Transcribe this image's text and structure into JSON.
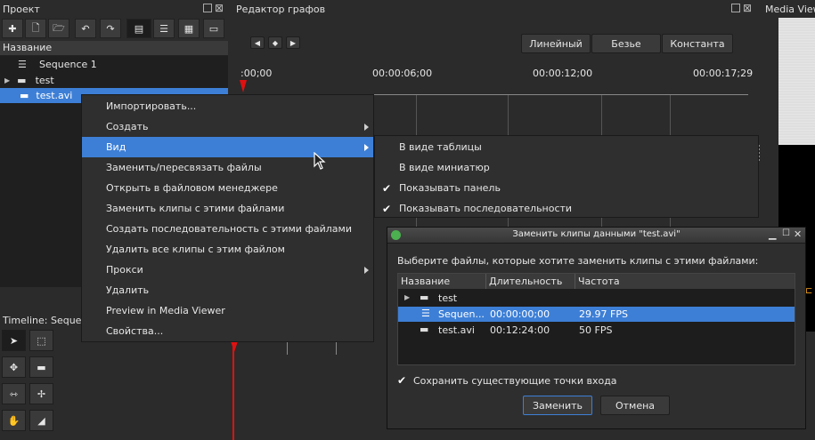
{
  "project": {
    "title": "Проект",
    "column": "Название",
    "items": [
      "Sequence 1",
      "test",
      "test.avi"
    ]
  },
  "graph": {
    "title": "Редактор графов",
    "btn_linear": "Линейный",
    "btn_bezier": "Безье",
    "btn_const": "Константа",
    "times": [
      ":00;00",
      "00:00:06;00",
      "00:00:12;00",
      "00:00:17;29"
    ]
  },
  "media": {
    "title": "Media View"
  },
  "timeline": {
    "title": "Timeline: Seque"
  },
  "context_menu": {
    "items": [
      "Импортировать...",
      "Создать",
      "Вид",
      "Заменить/пересвязать файлы",
      "Открыть в файловом менеджере",
      "Заменить клипы с этими файлами",
      "Создать последовательность с этими файлами",
      "Удалить все клипы с этим файлом",
      "Прокси",
      "Удалить",
      "Preview in Media Viewer",
      "Свойства..."
    ]
  },
  "submenu": {
    "items": [
      "В виде таблицы",
      "В виде миниатюр",
      "Показывать панель",
      "Показывать последовательности"
    ]
  },
  "dialog": {
    "title": "Заменить клипы данными \"test.avi\"",
    "prompt": "Выберите файлы, которые хотите заменить клипы с этими файлами:",
    "columns": [
      "Название",
      "Длительность",
      "Частота"
    ],
    "rows": [
      {
        "name": "test",
        "duration": "",
        "rate": ""
      },
      {
        "name": "Sequen...",
        "duration": "00:00:00;00",
        "rate": "29.97 FPS"
      },
      {
        "name": "test.avi",
        "duration": "00:12:24:00",
        "rate": "50 FPS"
      }
    ],
    "checkbox": "Сохранить существующие точки входа",
    "ok": "Заменить",
    "cancel": "Отмена"
  },
  "colors": {
    "accent": "#3d7fd6",
    "playhead": "#e01010"
  }
}
